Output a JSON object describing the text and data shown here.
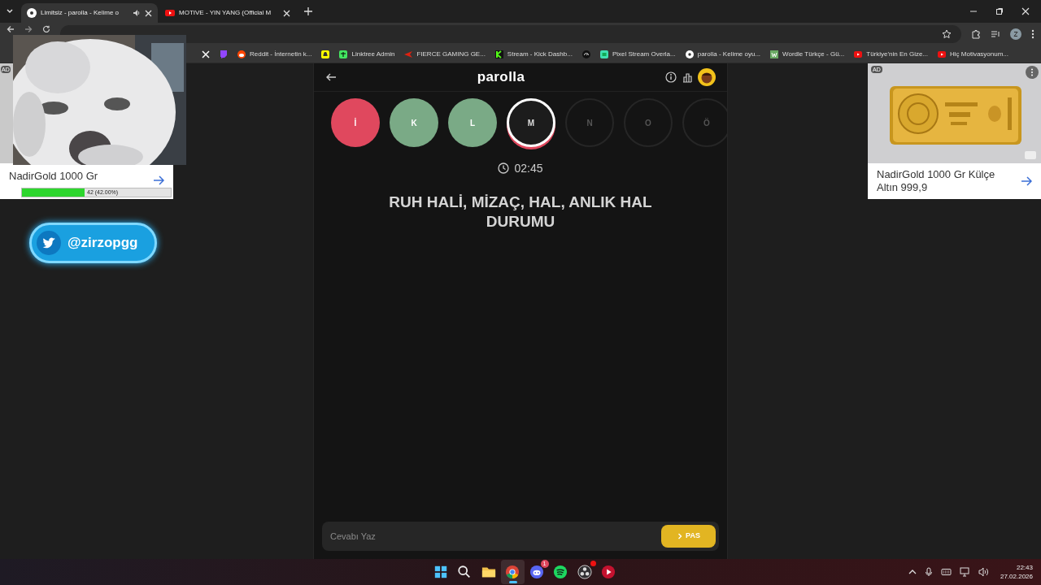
{
  "tabs": [
    {
      "title": "Limitsiz - parolla - Kelime o",
      "selected": true,
      "kind": "parolla",
      "audio": true
    },
    {
      "title": "MOTIVE - YIN YANG (Official M",
      "selected": false,
      "kind": "youtube",
      "audio": false
    }
  ],
  "bookmarks": [
    {
      "kind": "x"
    },
    {
      "kind": "twitch"
    },
    {
      "label": "Reddit - İnternetin k...",
      "kind": "reddit"
    },
    {
      "kind": "snap"
    },
    {
      "label": "Linktree Admin",
      "kind": "linktree"
    },
    {
      "label": "FIERCE GAMING GE...",
      "kind": "fierce"
    },
    {
      "label": "Stream - Kick Dashb...",
      "kind": "kick"
    },
    {
      "kind": "gauge"
    },
    {
      "label": "Pixel Stream Overla...",
      "kind": "pixel"
    },
    {
      "label": "parolla - Kelime oyu...",
      "kind": "parolla"
    },
    {
      "label": "Wordle Türkçe - Gü...",
      "kind": "wordle"
    },
    {
      "label": "Türkiye'nin En Gize...",
      "kind": "youtube"
    },
    {
      "label": "Hiç Motivasyonum...",
      "kind": "youtube"
    }
  ],
  "left_ad": {
    "badge": "AD",
    "title": "NadirGold 1000 Gr"
  },
  "overlay_progress": {
    "level": 0.42,
    "reading": "42 (42.00%)"
  },
  "social_badge": {
    "handle": "@zirzopgg"
  },
  "game": {
    "title": "parolla",
    "letters": [
      {
        "letter": "İ",
        "kind": "wrong"
      },
      {
        "letter": "K",
        "kind": "correct"
      },
      {
        "letter": "L",
        "kind": "correct"
      },
      {
        "letter": "M",
        "kind": "current"
      },
      {
        "letter": "N",
        "kind": "pending"
      },
      {
        "letter": "O",
        "kind": "pending"
      },
      {
        "letter": "Ö",
        "kind": "pending"
      }
    ],
    "timer": "02:45",
    "clue": "RUH HALİ, MİZAÇ, HAL, ANLIK HAL DURUMU",
    "answer": {
      "placeholder": "Cevabı Yaz"
    },
    "pass_button": "PAS"
  },
  "right_ad": {
    "badge": "AD",
    "title": "NadirGold 1000 Gr Külçe Altın 999,9"
  },
  "taskbar": {
    "apps": [
      {
        "kind": "start",
        "active": false
      },
      {
        "kind": "search",
        "active": false
      },
      {
        "kind": "folder",
        "active": false
      },
      {
        "kind": "chrome",
        "active": true
      },
      {
        "kind": "discord",
        "active": false,
        "badge": "1"
      },
      {
        "kind": "spotify",
        "active": false
      },
      {
        "kind": "obs",
        "active": false
      },
      {
        "kind": "media",
        "active": false
      }
    ],
    "time": "22:43",
    "date": "27.02.2026"
  }
}
